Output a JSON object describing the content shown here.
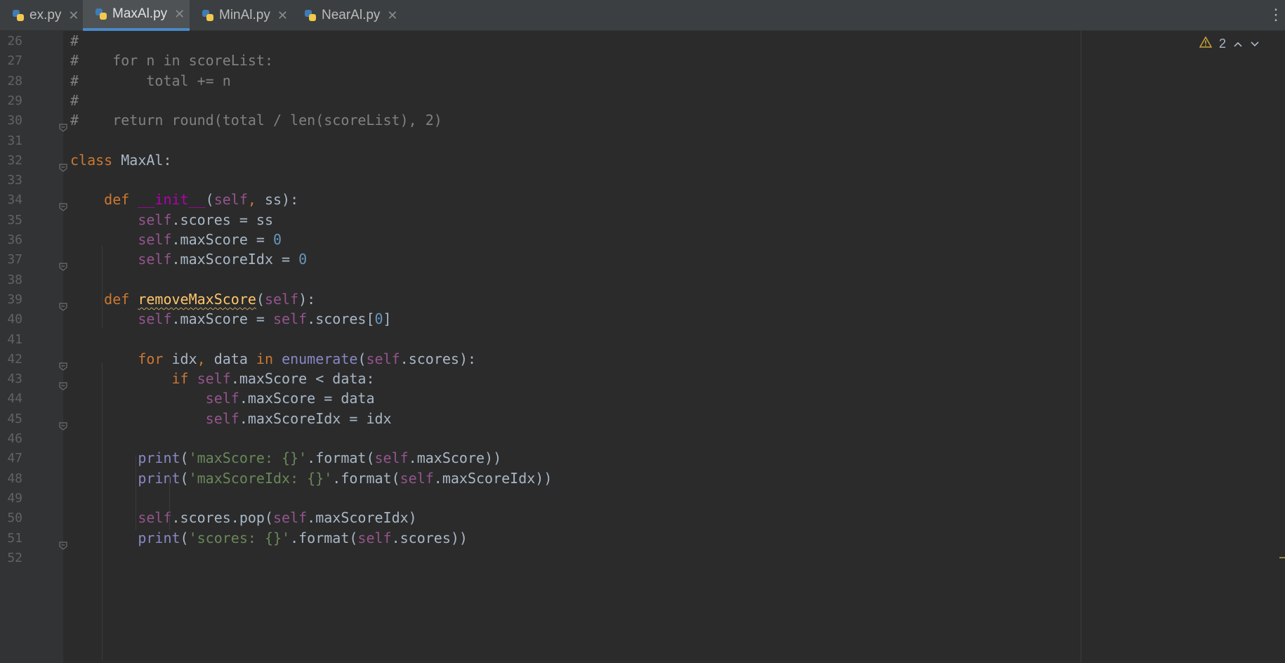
{
  "tabs": [
    {
      "label": "ex.py",
      "active": false
    },
    {
      "label": "MaxAl.py",
      "active": true
    },
    {
      "label": "MinAl.py",
      "active": false
    },
    {
      "label": "NearAl.py",
      "active": false
    }
  ],
  "tab_close_glyph": "✕",
  "tab_menu_glyph": "⋮",
  "inspection": {
    "warning_count": "2",
    "icon": "warning-triangle-icon",
    "up_icon": "chevron-up-icon",
    "down_icon": "chevron-down-icon"
  },
  "colors": {
    "keyword": "#cc7832",
    "self": "#94558d",
    "number": "#6897bb",
    "string": "#6a8759",
    "comment": "#808080",
    "function": "#ffc66d",
    "accent": "#4a88c7"
  },
  "lines": [
    {
      "num": "26",
      "code": "#"
    },
    {
      "num": "27",
      "code": "#    for n in scoreList:"
    },
    {
      "num": "28",
      "code": "#        total += n"
    },
    {
      "num": "29",
      "code": "#"
    },
    {
      "num": "30",
      "code": "#    return round(total / len(scoreList), 2)"
    },
    {
      "num": "31",
      "code": ""
    },
    {
      "num": "32",
      "code": "class MaxAl:"
    },
    {
      "num": "33",
      "code": ""
    },
    {
      "num": "34",
      "code": "    def __init__(self, ss):"
    },
    {
      "num": "35",
      "code": "        self.scores = ss"
    },
    {
      "num": "36",
      "code": "        self.maxScore = 0"
    },
    {
      "num": "37",
      "code": "        self.maxScoreIdx = 0"
    },
    {
      "num": "38",
      "code": ""
    },
    {
      "num": "39",
      "code": "    def removeMaxScore(self):"
    },
    {
      "num": "40",
      "code": "        self.maxScore = self.scores[0]"
    },
    {
      "num": "41",
      "code": ""
    },
    {
      "num": "42",
      "code": "        for idx, data in enumerate(self.scores):"
    },
    {
      "num": "43",
      "code": "            if self.maxScore < data:"
    },
    {
      "num": "44",
      "code": "                self.maxScore = data"
    },
    {
      "num": "45",
      "code": "                self.maxScoreIdx = idx"
    },
    {
      "num": "46",
      "code": ""
    },
    {
      "num": "47",
      "code": "        print('maxScore: {}'.format(self.maxScore))"
    },
    {
      "num": "48",
      "code": "        print('maxScoreIdx: {}'.format(self.maxScoreIdx))"
    },
    {
      "num": "49",
      "code": ""
    },
    {
      "num": "50",
      "code": "        self.scores.pop(self.maxScoreIdx)"
    },
    {
      "num": "51",
      "code": "        print('scores: {}'.format(self.scores))"
    },
    {
      "num": "52",
      "code": ""
    }
  ],
  "fold_lines": [
    "30",
    "32",
    "34",
    "37",
    "39",
    "42",
    "43",
    "45",
    "51"
  ],
  "warning_identifier": "removeMaxScore"
}
